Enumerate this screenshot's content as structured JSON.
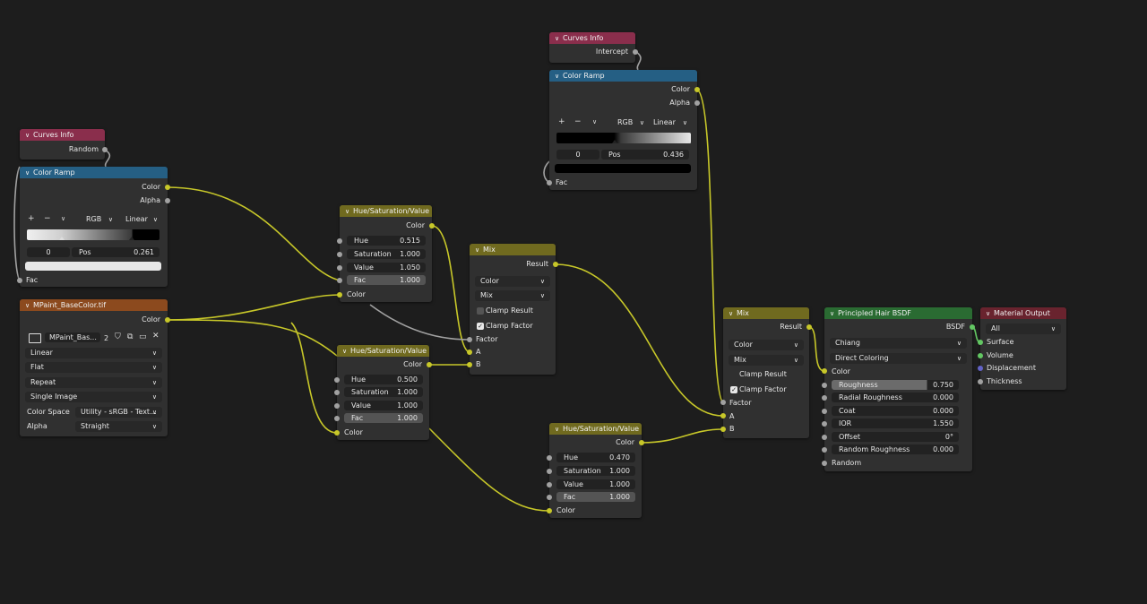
{
  "nodes": {
    "curves_info_1": {
      "title": "Curves Info",
      "out_random": "Random"
    },
    "color_ramp_1": {
      "title": "Color Ramp",
      "out_color": "Color",
      "out_alpha": "Alpha",
      "add": "+",
      "remove": "−",
      "menu": "∨",
      "color_mode": "RGB",
      "interpolation": "Linear",
      "stop_index": "0",
      "pos_label": "Pos",
      "pos_value": "0.261",
      "in_fac": "Fac"
    },
    "curves_info_2": {
      "title": "Curves Info",
      "out_intercept": "Intercept"
    },
    "color_ramp_2": {
      "title": "Color Ramp",
      "out_color": "Color",
      "out_alpha": "Alpha",
      "add": "+",
      "remove": "−",
      "menu": "∨",
      "color_mode": "RGB",
      "interpolation": "Linear",
      "stop_index": "0",
      "pos_label": "Pos",
      "pos_value": "0.436",
      "in_fac": "Fac"
    },
    "image_texture": {
      "title": "MPaint_BaseColor.tif",
      "out_color": "Color",
      "image_name": "MPaint_Bas...",
      "users": "2",
      "interpolation": "Linear",
      "projection": "Flat",
      "extension": "Repeat",
      "source": "Single Image",
      "color_space_label": "Color Space",
      "color_space": "Utility - sRGB - Text...",
      "alpha_label": "Alpha",
      "alpha": "Straight"
    },
    "hsv_1": {
      "title": "Hue/Saturation/Value",
      "out_color": "Color",
      "hue_label": "Hue",
      "hue": "0.515",
      "sat_label": "Saturation",
      "sat": "1.000",
      "val_label": "Value",
      "val": "1.050",
      "fac_label": "Fac",
      "fac": "1.000",
      "in_color": "Color"
    },
    "hsv_2": {
      "title": "Hue/Saturation/Value",
      "out_color": "Color",
      "hue_label": "Hue",
      "hue": "0.500",
      "sat_label": "Saturation",
      "sat": "1.000",
      "val_label": "Value",
      "val": "1.000",
      "fac_label": "Fac",
      "fac": "1.000",
      "in_color": "Color"
    },
    "hsv_3": {
      "title": "Hue/Saturation/Value",
      "out_color": "Color",
      "hue_label": "Hue",
      "hue": "0.470",
      "sat_label": "Saturation",
      "sat": "1.000",
      "val_label": "Value",
      "val": "1.000",
      "fac_label": "Fac",
      "fac": "1.000",
      "in_color": "Color"
    },
    "mix_1": {
      "title": "Mix",
      "out_result": "Result",
      "data_type": "Color",
      "blend": "Mix",
      "clamp_result": "Clamp Result",
      "clamp_factor": "Clamp Factor",
      "in_factor": "Factor",
      "in_a": "A",
      "in_b": "B"
    },
    "mix_2": {
      "title": "Mix",
      "out_result": "Result",
      "data_type": "Color",
      "blend": "Mix",
      "clamp_result": "Clamp Result",
      "clamp_factor": "Clamp Factor",
      "in_factor": "Factor",
      "in_a": "A",
      "in_b": "B"
    },
    "hair_bsdf": {
      "title": "Principled Hair BSDF",
      "out_bsdf": "BSDF",
      "model": "Chiang",
      "parametrization": "Direct Coloring",
      "in_color": "Color",
      "roughness_label": "Roughness",
      "roughness": "0.750",
      "radial_label": "Radial Roughness",
      "radial": "0.000",
      "coat_label": "Coat",
      "coat": "0.000",
      "ior_label": "IOR",
      "ior": "1.550",
      "offset_label": "Offset",
      "offset": "0°",
      "random_rough_label": "Random Roughness",
      "random_rough": "0.000",
      "in_random": "Random"
    },
    "material_output": {
      "title": "Material Output",
      "target": "All",
      "in_surface": "Surface",
      "in_volume": "Volume",
      "in_displacement": "Displacement",
      "in_thickness": "Thickness"
    }
  },
  "colors": {
    "background": "#1d1d1d",
    "node_body": "#303030",
    "input_header": "#8a2e4c",
    "converter_header": "#255f84",
    "color_header": "#706a1f",
    "texture_header": "#8c4a1e",
    "shader_header": "#2a6b32",
    "output_header": "#69232e",
    "socket_color": "#c7c729",
    "socket_float": "#a1a1a1",
    "socket_shader": "#63c763",
    "socket_vector": "#6363c7"
  },
  "icons": [
    "image-icon",
    "shield-icon",
    "duplicate-icon",
    "folder-icon",
    "close-icon",
    "chevron-down-icon",
    "checkbox-icon"
  ]
}
